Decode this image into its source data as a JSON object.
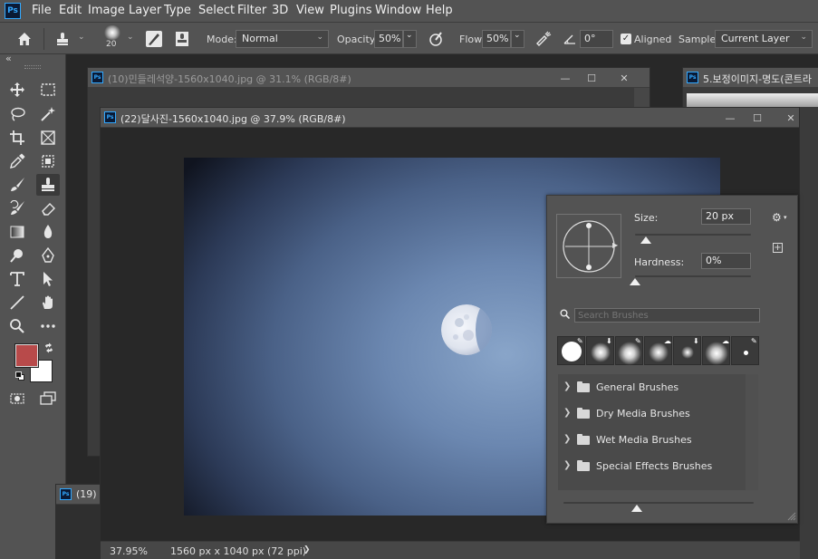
{
  "app": {
    "logo": "Ps"
  },
  "menu": [
    "File",
    "Edit",
    "Image",
    "Layer",
    "Type",
    "Select",
    "Filter",
    "3D",
    "View",
    "Plugins",
    "Window",
    "Help"
  ],
  "options": {
    "brush_size": "20",
    "mode_label": "Mode:",
    "mode_value": "Normal",
    "opacity_label": "Opacity:",
    "opacity_value": "50%",
    "flow_label": "Flow:",
    "flow_value": "50%",
    "angle_value": "0°",
    "aligned_label": "Aligned",
    "aligned_checked": true,
    "sample_label": "Sample:",
    "sample_value": "Current Layer"
  },
  "toolbar": {
    "collapse": "«",
    "swap_icon": "swap-colors-icon",
    "foreground_color": "#b84a4a",
    "background_color": "#ffffff"
  },
  "documents": {
    "doc_back": {
      "title": "(10)민들레석양-1560x1040.jpg @ 31.1% (RGB/8#)"
    },
    "doc_right": {
      "title": "5.보정이미지-명도(콘트라"
    },
    "doc_bottom": {
      "title": "(19)"
    },
    "doc_front": {
      "title": "(22)달사진-1560x1040.jpg @ 37.9% (RGB/8#)"
    }
  },
  "brush_panel": {
    "size_label": "Size:",
    "size_value": "20 px",
    "hardness_label": "Hardness:",
    "hardness_value": "0%",
    "search_placeholder": "Search Brushes",
    "folders": [
      "General Brushes",
      "Dry Media Brushes",
      "Wet Media Brushes",
      "Special Effects Brushes"
    ]
  },
  "status": {
    "zoom": "37.95%",
    "doc_info": "1560 px x 1040 px (72 ppi)",
    "arrow": "❯"
  }
}
